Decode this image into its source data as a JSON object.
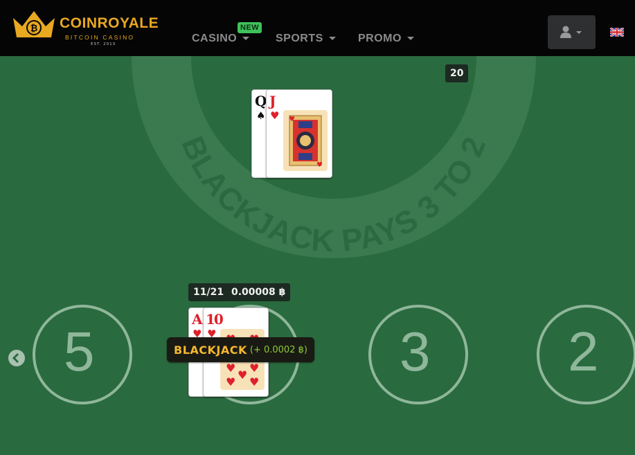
{
  "header": {
    "logo": {
      "title": "COINROYALE",
      "subtitle": "BITCOIN CASINO",
      "est": "EST. 2013"
    },
    "nav": [
      {
        "label": "CASINO",
        "badge": "NEW"
      },
      {
        "label": "SPORTS"
      },
      {
        "label": "PROMO"
      }
    ],
    "user_menu_icon": "user-icon",
    "language_flag": "uk-flag"
  },
  "table": {
    "felt_text": "BLACKJACK PAYS 3 TO 2",
    "dealer": {
      "score": "20",
      "cards": [
        {
          "rank": "Q",
          "suit": "♠",
          "color": "black"
        },
        {
          "rank": "J",
          "suit": "♥",
          "color": "red"
        }
      ]
    },
    "player": {
      "score": "11/21",
      "bet": "0.00008 ฿",
      "cards": [
        {
          "rank": "A",
          "suit": "♥",
          "color": "red"
        },
        {
          "rank": "10",
          "suit": "♥",
          "color": "red"
        }
      ],
      "result": {
        "label": "BLACKJACK",
        "win": "(+ 0.0002 ฿)"
      }
    },
    "seats": [
      "5",
      "3",
      "2"
    ],
    "colors": {
      "felt": "#2a6a3f",
      "red": "#e0202a",
      "gold": "#f5b82e",
      "win_green": "#8fcb3a"
    }
  }
}
